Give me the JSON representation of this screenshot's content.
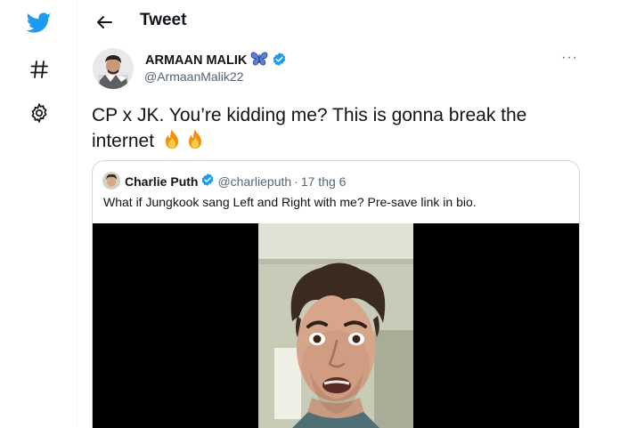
{
  "header": {
    "title": "Tweet"
  },
  "rail": {
    "icons": [
      "twitter-bird-icon",
      "hashtag-icon",
      "gear-icon"
    ]
  },
  "tweet": {
    "author_name": "ARMAAN MALIK",
    "author_handle": "@ArmaanMalik22",
    "text": "CP x JK. You’re kidding me? This is gonna break the internet",
    "more_label": "···"
  },
  "quote": {
    "name": "Charlie Puth",
    "handle": "@charlieputh",
    "separator": "·",
    "date": "17 thg 6",
    "text": "What if Jungkook sang Left and Right with me? Pre-save link in bio."
  },
  "colors": {
    "brand": "#1d9bf0",
    "text": "#0f1419",
    "muted": "#536471",
    "border": "#cfd9de"
  }
}
